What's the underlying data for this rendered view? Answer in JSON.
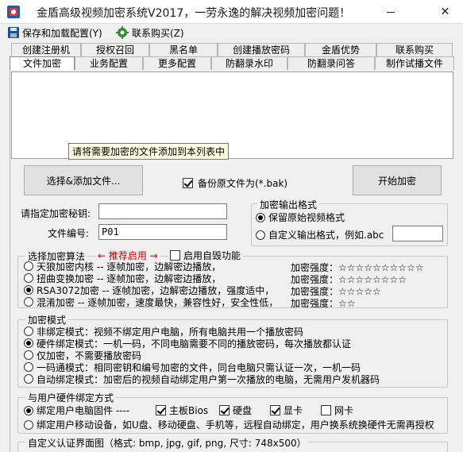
{
  "window": {
    "title": "金盾高级视频加密系统V2017，一劳永逸的解决视频加密问题！",
    "close_glyph": "✕"
  },
  "menu": {
    "save_label": "保存和加载配置(Y)",
    "contact_label": "联系购买(Z)"
  },
  "tabs_top": [
    "创建注册机",
    "授权召回",
    "黑名单",
    "创建播放密码",
    "金盾优势",
    "联系购买"
  ],
  "tabs_bottom": [
    "文件加密",
    "业务配置",
    "更多配置",
    "防翻录水印",
    "防翻录问答",
    "制作试播文件"
  ],
  "active_tab": "文件加密",
  "filelist": {
    "tooltip": "请将需要加密的文件添加到本列表中"
  },
  "actions": {
    "add_files_label": "选择&添加文件...",
    "backup_label": "备份原文件为(*.bak)",
    "backup_checked": true,
    "start_label": "开始加密"
  },
  "key_field": {
    "label": "请指定加密秘钥:",
    "value": ""
  },
  "file_no": {
    "label": "文件编号:",
    "value": "P01"
  },
  "output_format": {
    "title": "加密输出格式",
    "keep_label": "保留原始视频格式",
    "custom_label": "自定义输出格式，例如.abc",
    "custom_value": "",
    "selected": "keep"
  },
  "algorithm": {
    "title": "选择加密算法",
    "recommend": "← 推荐启用 →",
    "self_destroy_label": "启用自毁功能",
    "self_destroy_checked": false,
    "options": [
      {
        "label": "天狼加密内核 -- 逐帧加密，边解密边播放，",
        "strength": "加密强度：☆☆☆☆☆☆☆☆☆☆",
        "selected": false
      },
      {
        "label": "扭曲变换加密 -- 逐帧加密，边解密边播放，",
        "strength": "加密强度：☆☆☆☆☆☆☆☆",
        "selected": false
      },
      {
        "label": "RSA3072加密 -- 逐帧加密，边解密边播放，强度适中，",
        "strength": "加密强度：☆☆☆☆☆",
        "selected": true
      },
      {
        "label": "混淆加密 -- 逐帧加密，速度最快，兼容性好，安全性低，",
        "strength": "加密强度：☆☆",
        "selected": false
      }
    ]
  },
  "encrypt_mode": {
    "title": "加密模式",
    "options": [
      {
        "label": "非绑定模式：视频不绑定用户电脑，所有电脑共用一个播放密码",
        "selected": false
      },
      {
        "label": "硬件绑定模式：一机一码，不同电脑需要不同的播放密码，每次播放都认证",
        "selected": true
      },
      {
        "label": "仅加密，不需要播放密码",
        "selected": false
      },
      {
        "label": "一码通模式：相同密钥和编号加密的文件，同台电脑只需认证一次，一机一码",
        "selected": false
      },
      {
        "label": "自动绑定模式：加密后的视频自动绑定用户第一次播放的电脑，无需用户发机器码",
        "selected": false
      }
    ]
  },
  "hardware_bind": {
    "title": "与用户硬件绑定方式",
    "pc_label": "绑定用户电脑固件 ----",
    "pc_selected": true,
    "checks": [
      {
        "label": "主板Bios",
        "checked": true
      },
      {
        "label": "硬盘",
        "checked": true
      },
      {
        "label": "显卡",
        "checked": true
      },
      {
        "label": "网卡",
        "checked": false
      }
    ],
    "mobile_label": "绑定用户移动设备，如U盘、移动硬盘、手机等，远程自动绑定，用户换系统换硬件无需再授权",
    "mobile_selected": false
  },
  "custom_auth": {
    "title": "自定义认证界面图（格式: bmp, jpg, gif, png, 尺寸: 748x500）"
  }
}
